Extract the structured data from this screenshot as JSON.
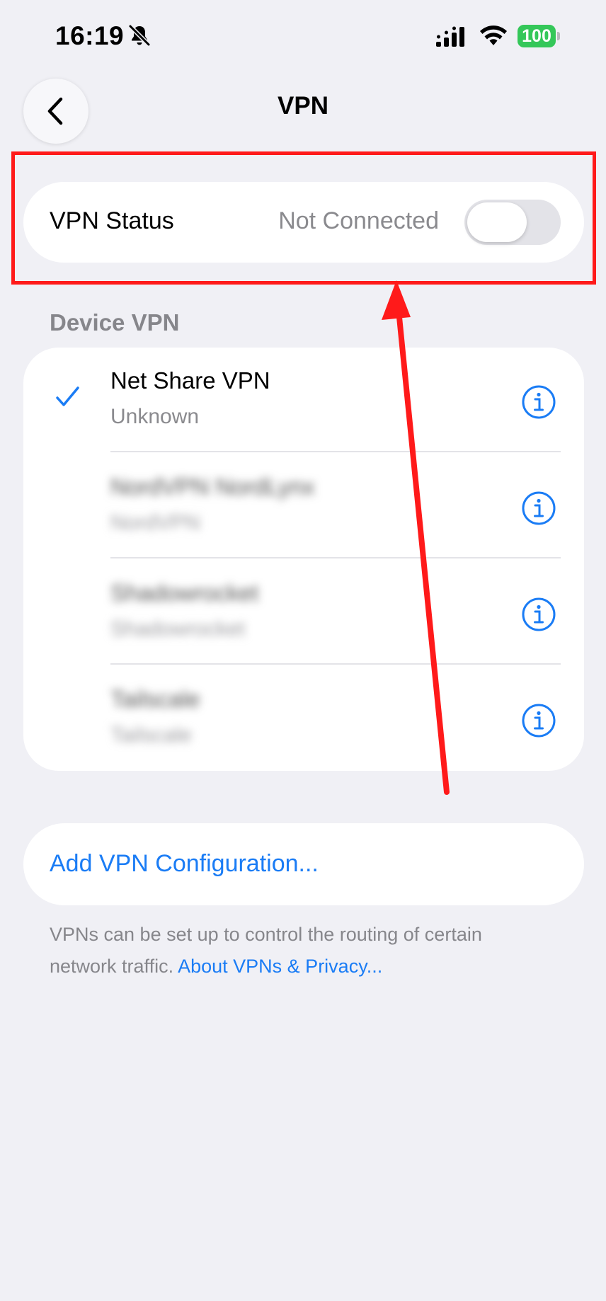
{
  "status_bar": {
    "time": "16:19",
    "battery": "100"
  },
  "nav": {
    "title": "VPN"
  },
  "vpn_status": {
    "label": "VPN Status",
    "value": "Not Connected",
    "toggle_on": false
  },
  "device_vpn": {
    "header": "Device VPN",
    "items": [
      {
        "name": "Net Share VPN",
        "subtitle": "Unknown",
        "selected": true,
        "blurred": false
      },
      {
        "name": "NordVPN NordLynx",
        "subtitle": "NordVPN",
        "selected": false,
        "blurred": true
      },
      {
        "name": "Shadowrocket",
        "subtitle": "Shadowrocket",
        "selected": false,
        "blurred": true
      },
      {
        "name": "Tailscale",
        "subtitle": "Tailscale",
        "selected": false,
        "blurred": true
      }
    ]
  },
  "add_config": {
    "label": "Add VPN Configuration..."
  },
  "footer": {
    "text": "VPNs can be set up to control the routing of certain network traffic.",
    "link": "About VPNs & Privacy..."
  },
  "colors": {
    "accent": "#1a7cf5",
    "battery": "#34c759",
    "annotation": "#ff1a1a",
    "background": "#f0f0f5"
  },
  "icons": {
    "back": "chevron-left-icon",
    "check": "checkmark-icon",
    "info": "info-circle-icon",
    "silent": "bell-slash-icon",
    "signal": "cellular-signal-icon",
    "wifi": "wifi-icon"
  }
}
